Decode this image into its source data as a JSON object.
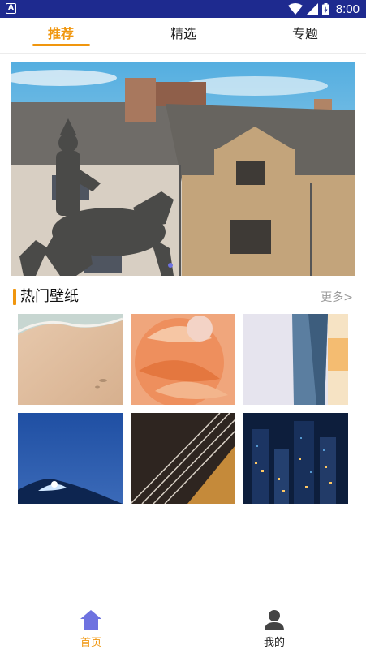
{
  "status_bar": {
    "app_badge": "A",
    "time": "8:00",
    "icons": [
      "wifi-icon",
      "signal-icon",
      "battery-icon"
    ]
  },
  "tabs": [
    {
      "label": "推荐",
      "active": true
    },
    {
      "label": "精选",
      "active": false
    },
    {
      "label": "专题",
      "active": false
    }
  ],
  "banner": {
    "description_icon": "banner-image",
    "page_indicator_count": 1
  },
  "hot_wallpapers": {
    "title": "热门壁纸",
    "more_label": "更多>",
    "items": [
      {
        "name": "beach"
      },
      {
        "name": "flower"
      },
      {
        "name": "skyscraper"
      },
      {
        "name": "ice-blue"
      },
      {
        "name": "violin"
      },
      {
        "name": "city-night"
      }
    ]
  },
  "bottom_nav": [
    {
      "label": "首页",
      "icon": "home-icon",
      "active": true
    },
    {
      "label": "我的",
      "icon": "user-icon",
      "active": false
    }
  ],
  "colors": {
    "accent": "#f0960e",
    "status_bar": "#1e2a8f",
    "nav_active_icon": "#6e72e0",
    "nav_inactive_icon": "#444444"
  }
}
